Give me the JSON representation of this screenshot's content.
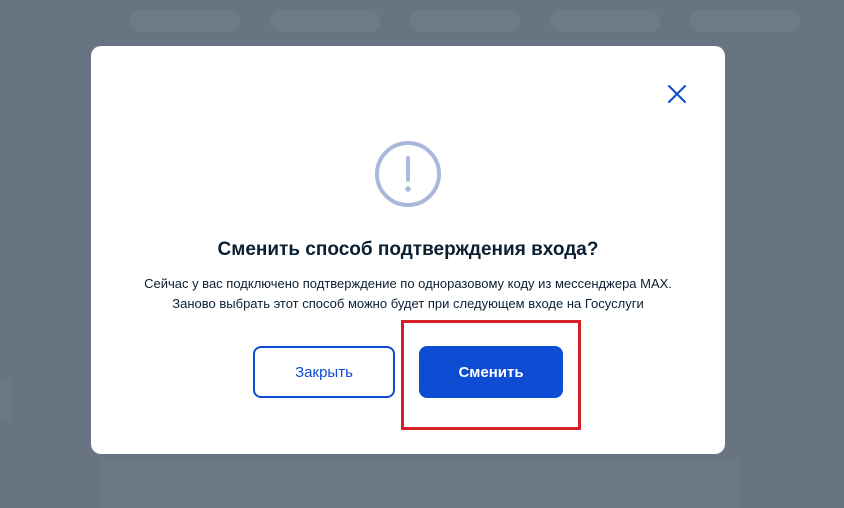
{
  "modal": {
    "title": "Сменить способ подтверждения входа?",
    "description_line1": "Сейчас у вас подключено подтверждение по одноразовому коду из мессенджера MAX.",
    "description_line2": "Заново выбрать этот способ можно будет при следующем входе на Госуслуги",
    "close_button_label": "Закрыть",
    "change_button_label": "Сменить"
  },
  "colors": {
    "primary": "#0d4cd3",
    "overlay": "#687482",
    "text": "#0b1f33",
    "icon_ring": "#a8b9dc",
    "highlight": "#d42128"
  },
  "icons": {
    "close": "close-icon",
    "alert": "exclamation-circle-icon"
  }
}
